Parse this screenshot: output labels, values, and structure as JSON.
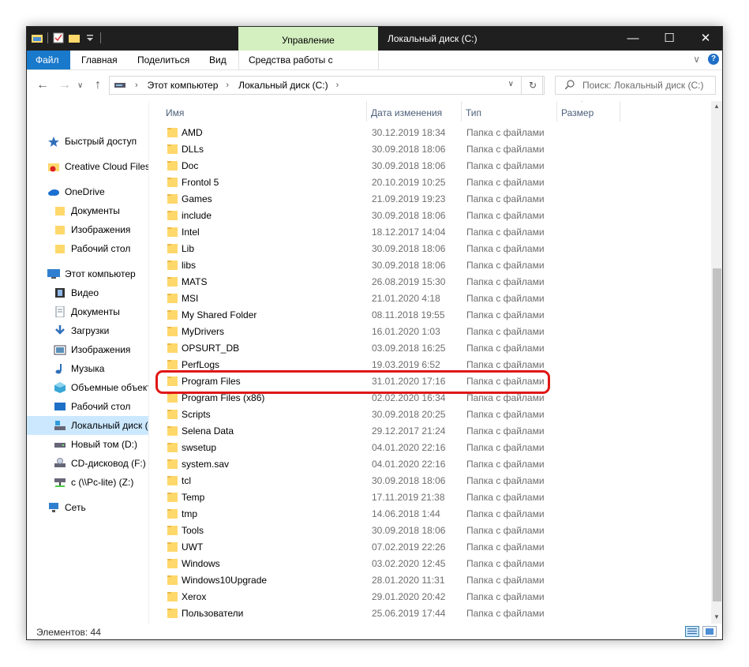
{
  "window": {
    "title": "Локальный диск (C:)",
    "context_tab": "Управление",
    "controls": {
      "minimize": "—",
      "maximize": "☐",
      "close": "✕"
    }
  },
  "ribbon": {
    "tabs": [
      "Файл",
      "Главная",
      "Поделиться",
      "Вид",
      "Средства работы с дисками"
    ],
    "collapse": "∨",
    "help": "?"
  },
  "address": {
    "back": "←",
    "forward": "→",
    "recent": "∨",
    "up": "↑",
    "crumbs": [
      "Этот компьютер",
      "Локальный диск (C:)"
    ],
    "refresh": "↻"
  },
  "search": {
    "placeholder": "Поиск: Локальный диск (C:)"
  },
  "sidebar": {
    "items": [
      {
        "label": "Быстрый доступ",
        "icon": "star-icon"
      },
      {
        "label": "Creative Cloud Files",
        "icon": "creative-cloud-icon"
      },
      {
        "label": "OneDrive",
        "icon": "cloud-icon"
      },
      {
        "label": "Документы",
        "icon": "folder-icon"
      },
      {
        "label": "Изображения",
        "icon": "folder-icon"
      },
      {
        "label": "Рабочий стол",
        "icon": "folder-icon"
      },
      {
        "label": "Этот компьютер",
        "icon": "computer-icon"
      },
      {
        "label": "Видео",
        "icon": "video-icon"
      },
      {
        "label": "Документы",
        "icon": "documents-icon"
      },
      {
        "label": "Загрузки",
        "icon": "download-icon"
      },
      {
        "label": "Изображения",
        "icon": "pictures-icon"
      },
      {
        "label": "Музыка",
        "icon": "music-icon"
      },
      {
        "label": "Объемные объект",
        "icon": "3d-objects-icon"
      },
      {
        "label": "Рабочий стол",
        "icon": "desktop-icon"
      },
      {
        "label": "Локальный диск (С",
        "icon": "system-drive-icon"
      },
      {
        "label": "Новый том (D:)",
        "icon": "drive-icon"
      },
      {
        "label": "CD-дисковод (F:)",
        "icon": "cd-drive-icon"
      },
      {
        "label": "c (\\\\Pc-lite) (Z:)",
        "icon": "network-drive-icon"
      },
      {
        "label": "Сеть",
        "icon": "network-icon"
      }
    ]
  },
  "columns": {
    "name": "Имя",
    "date": "Дата изменения",
    "type": "Тип",
    "size": "Размер"
  },
  "files": [
    {
      "name": "AMD",
      "date": "30.12.2019 18:34",
      "type": "Папка с файлами"
    },
    {
      "name": "DLLs",
      "date": "30.09.2018 18:06",
      "type": "Папка с файлами"
    },
    {
      "name": "Doc",
      "date": "30.09.2018 18:06",
      "type": "Папка с файлами"
    },
    {
      "name": "Frontol 5",
      "date": "20.10.2019 10:25",
      "type": "Папка с файлами"
    },
    {
      "name": "Games",
      "date": "21.09.2019 19:23",
      "type": "Папка с файлами"
    },
    {
      "name": "include",
      "date": "30.09.2018 18:06",
      "type": "Папка с файлами"
    },
    {
      "name": "Intel",
      "date": "18.12.2017 14:04",
      "type": "Папка с файлами"
    },
    {
      "name": "Lib",
      "date": "30.09.2018 18:06",
      "type": "Папка с файлами"
    },
    {
      "name": "libs",
      "date": "30.09.2018 18:06",
      "type": "Папка с файлами"
    },
    {
      "name": "MATS",
      "date": "26.08.2019 15:30",
      "type": "Папка с файлами"
    },
    {
      "name": "MSI",
      "date": "21.01.2020 4:18",
      "type": "Папка с файлами"
    },
    {
      "name": "My Shared Folder",
      "date": "08.11.2018 19:55",
      "type": "Папка с файлами"
    },
    {
      "name": "MyDrivers",
      "date": "16.01.2020 1:03",
      "type": "Папка с файлами"
    },
    {
      "name": "OPSURT_DB",
      "date": "03.09.2018 16:25",
      "type": "Папка с файлами"
    },
    {
      "name": "PerfLogs",
      "date": "19.03.2019 6:52",
      "type": "Папка с файлами"
    },
    {
      "name": "Program Files",
      "date": "31.01.2020 17:16",
      "type": "Папка с файлами"
    },
    {
      "name": "Program Files (x86)",
      "date": "02.02.2020 16:34",
      "type": "Папка с файлами"
    },
    {
      "name": "Scripts",
      "date": "30.09.2018 20:25",
      "type": "Папка с файлами"
    },
    {
      "name": "Selena Data",
      "date": "29.12.2017 21:24",
      "type": "Папка с файлами"
    },
    {
      "name": "swsetup",
      "date": "04.01.2020 22:16",
      "type": "Папка с файлами"
    },
    {
      "name": "system.sav",
      "date": "04.01.2020 22:16",
      "type": "Папка с файлами"
    },
    {
      "name": "tcl",
      "date": "30.09.2018 18:06",
      "type": "Папка с файлами"
    },
    {
      "name": "Temp",
      "date": "17.11.2019 21:38",
      "type": "Папка с файлами"
    },
    {
      "name": "tmp",
      "date": "14.06.2018 1:44",
      "type": "Папка с файлами"
    },
    {
      "name": "Tools",
      "date": "30.09.2018 18:06",
      "type": "Папка с файлами"
    },
    {
      "name": "UWT",
      "date": "07.02.2019 22:26",
      "type": "Папка с файлами"
    },
    {
      "name": "Windows",
      "date": "03.02.2020 12:45",
      "type": "Папка с файлами"
    },
    {
      "name": "Windows10Upgrade",
      "date": "28.01.2020 11:31",
      "type": "Папка с файлами"
    },
    {
      "name": "Xerox",
      "date": "29.01.2020 20:42",
      "type": "Папка с файлами"
    },
    {
      "name": "Пользователи",
      "date": "25.06.2019 17:44",
      "type": "Папка с файлами"
    }
  ],
  "status": {
    "count": "Элементов: 44"
  },
  "colors": {
    "accent": "#1979ca",
    "context_tab": "#d4efc0",
    "titlebar": "#1f1f1f",
    "highlight": "#e01616",
    "folder": "#ffd86b"
  }
}
